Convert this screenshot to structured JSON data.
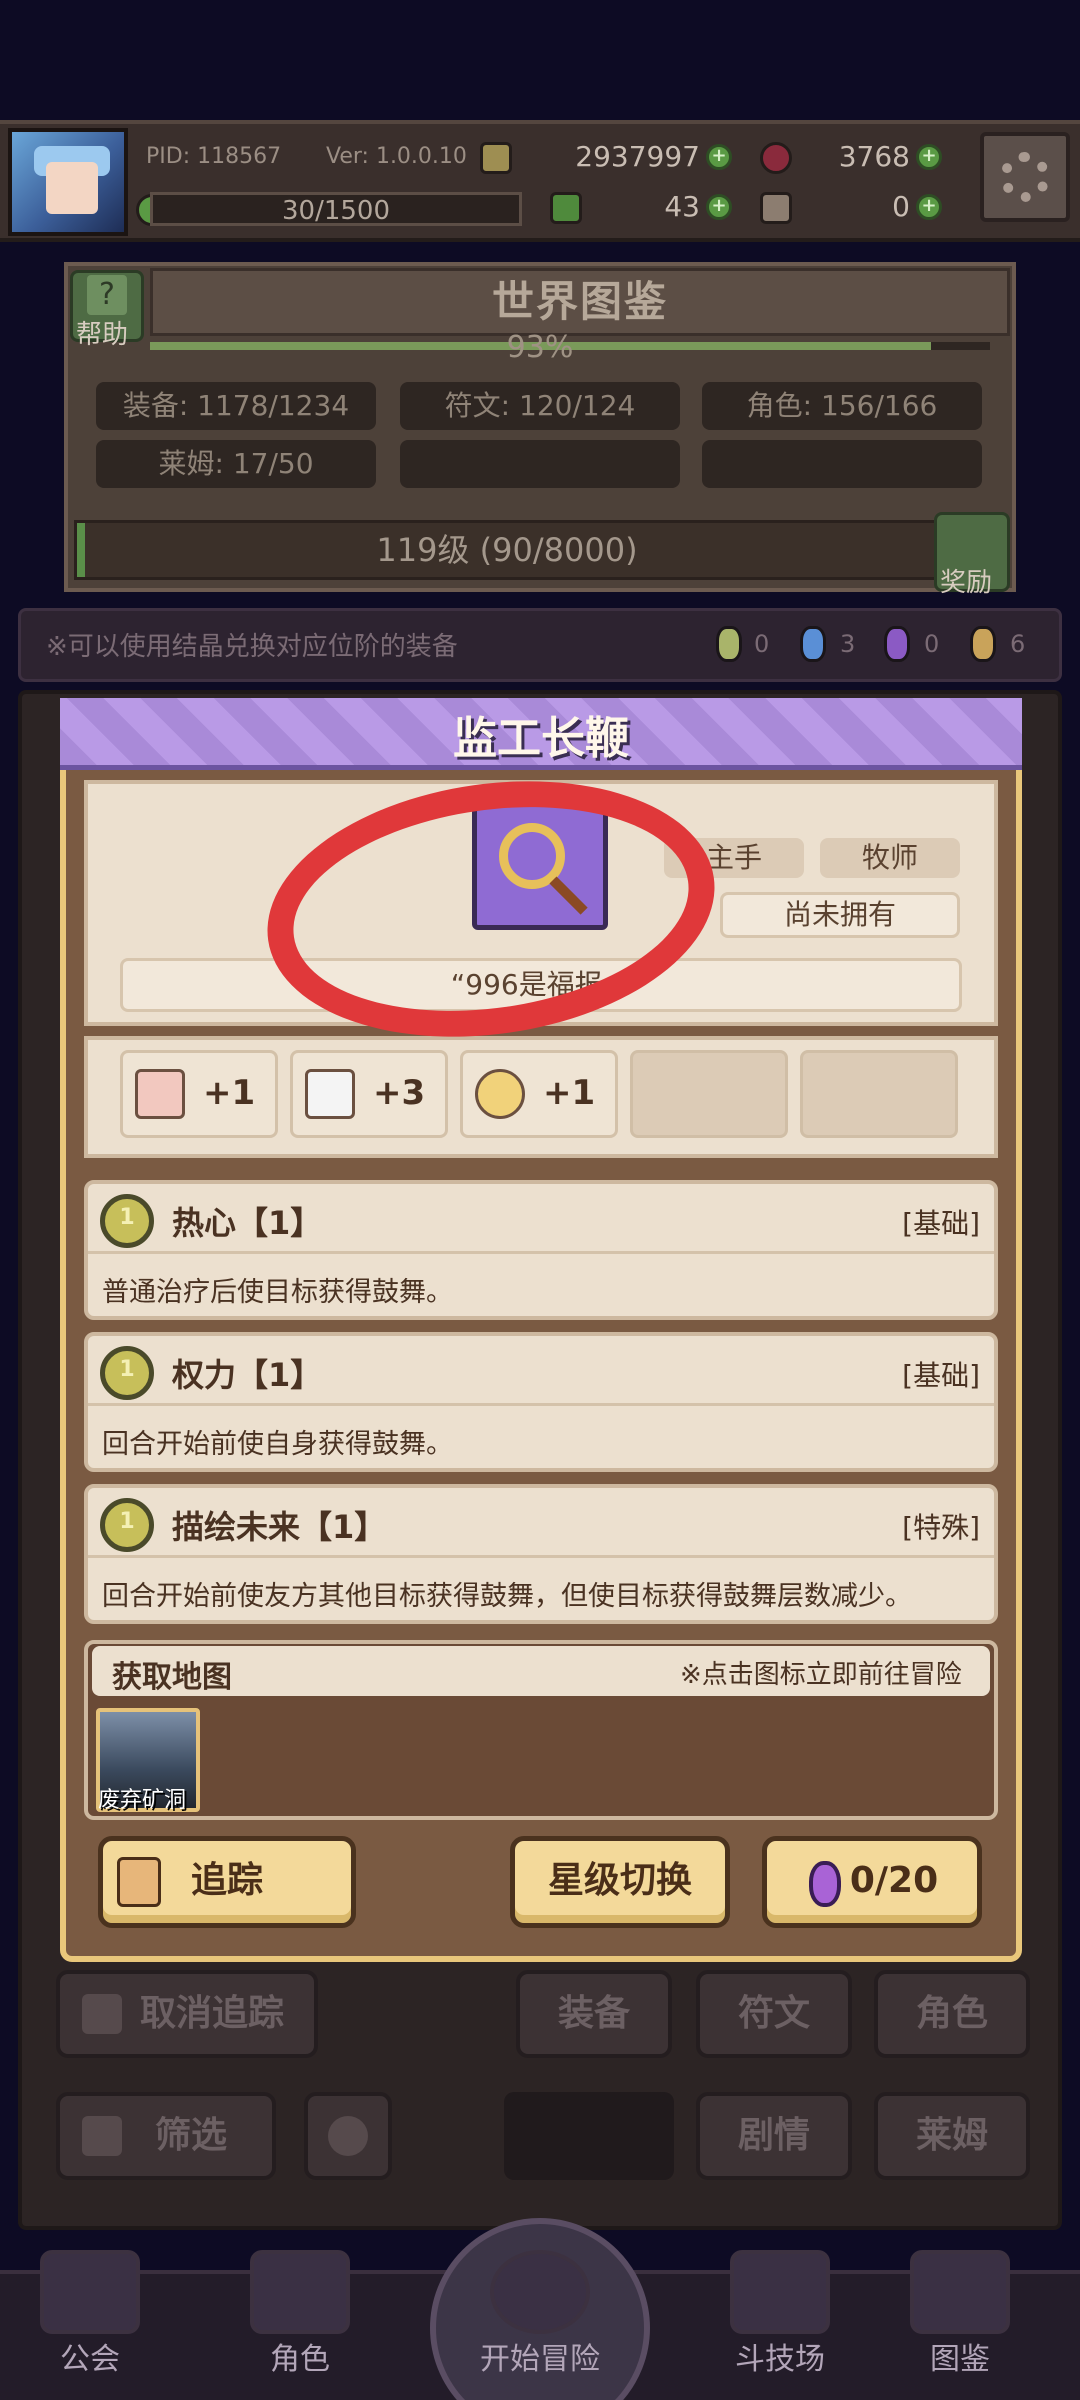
{
  "status_bar": {
    "pid": "PID: 118567",
    "version": "Ver: 1.0.0.10",
    "gold": "2937997",
    "ruby": "3768",
    "stamina": "30/1500",
    "clover": "43",
    "key": "0"
  },
  "codex": {
    "title": "世界图鉴",
    "help_label": "帮助",
    "percent": "93%",
    "stats": [
      "装备: 1178/1234",
      "符文: 120/124",
      "角色: 156/166",
      "莱姆: 17/50"
    ],
    "level": "119级 (90/8000)",
    "reward_label": "奖励"
  },
  "exchange": {
    "note": "※可以使用结晶兑换对应位阶的装备",
    "gems": [
      {
        "color": "#a9b46a",
        "count": "0"
      },
      {
        "color": "#5a8fd6",
        "count": "3"
      },
      {
        "color": "#8b5ac4",
        "count": "0"
      },
      {
        "color": "#c9a35a",
        "count": "6"
      }
    ]
  },
  "item": {
    "name": "监工长鞭",
    "slot": "主手",
    "class": "牧师",
    "owned_status": "尚未拥有",
    "quote": "“996是福报。”",
    "bonuses": [
      {
        "icon": "fist-icon",
        "value": "+1"
      },
      {
        "icon": "book-icon",
        "value": "+3"
      },
      {
        "icon": "horseshoe-icon",
        "value": "+1"
      }
    ],
    "skills": [
      {
        "medal": "1",
        "name": "热心【1】",
        "type": "[基础]",
        "desc": "普通治疗后使目标获得鼓舞。"
      },
      {
        "medal": "1",
        "name": "权力【1】",
        "type": "[基础]",
        "desc": "回合开始前使自身获得鼓舞。"
      },
      {
        "medal": "1",
        "name": "描绘未来【1】",
        "type": "[特殊]",
        "desc": "回合开始前使友方其他目标获得鼓舞，但使目标获得鼓舞层数减少。"
      }
    ],
    "map": {
      "title": "获取地图",
      "note": "※点击图标立即前往冒险",
      "location": "废弃矿洞"
    },
    "actions": {
      "track": "追踪",
      "star_switch": "星级切换",
      "gems": "0/20"
    }
  },
  "background_controls": {
    "cancel_track": "取消追踪",
    "filter": "筛选",
    "tabs": [
      "装备",
      "符文",
      "角色",
      "剧情",
      "莱姆"
    ]
  },
  "bottom_nav": [
    "公会",
    "角色",
    "开始冒险",
    "斗技场",
    "图鉴"
  ],
  "annotation_color": "#e0383a"
}
